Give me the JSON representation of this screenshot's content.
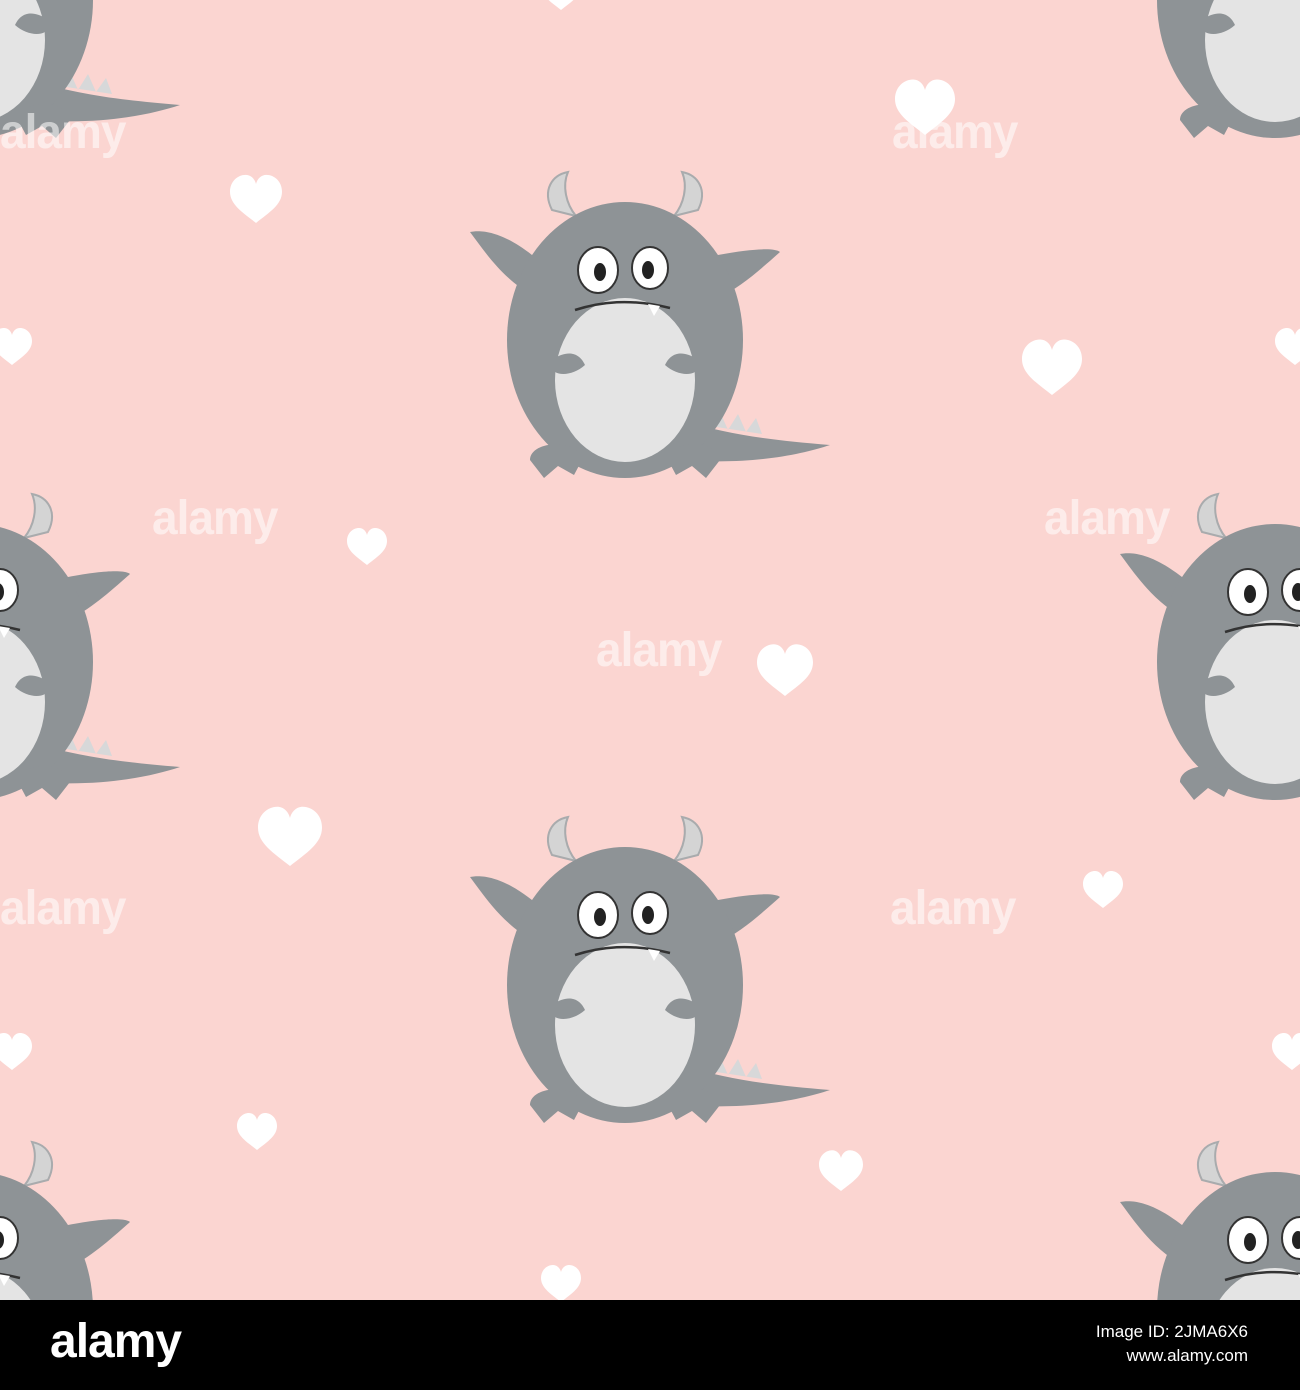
{
  "image": {
    "background_color": "#fbd5d1",
    "monster_body_color": "#8e9396",
    "monster_belly_color": "#e4e4e4",
    "heart_color": "#ffffff",
    "watermark_text": "alamy"
  },
  "footer": {
    "logo": "alamy",
    "line1": "Image ID: 2JMA6X6",
    "line2": "www.alamy.com"
  }
}
